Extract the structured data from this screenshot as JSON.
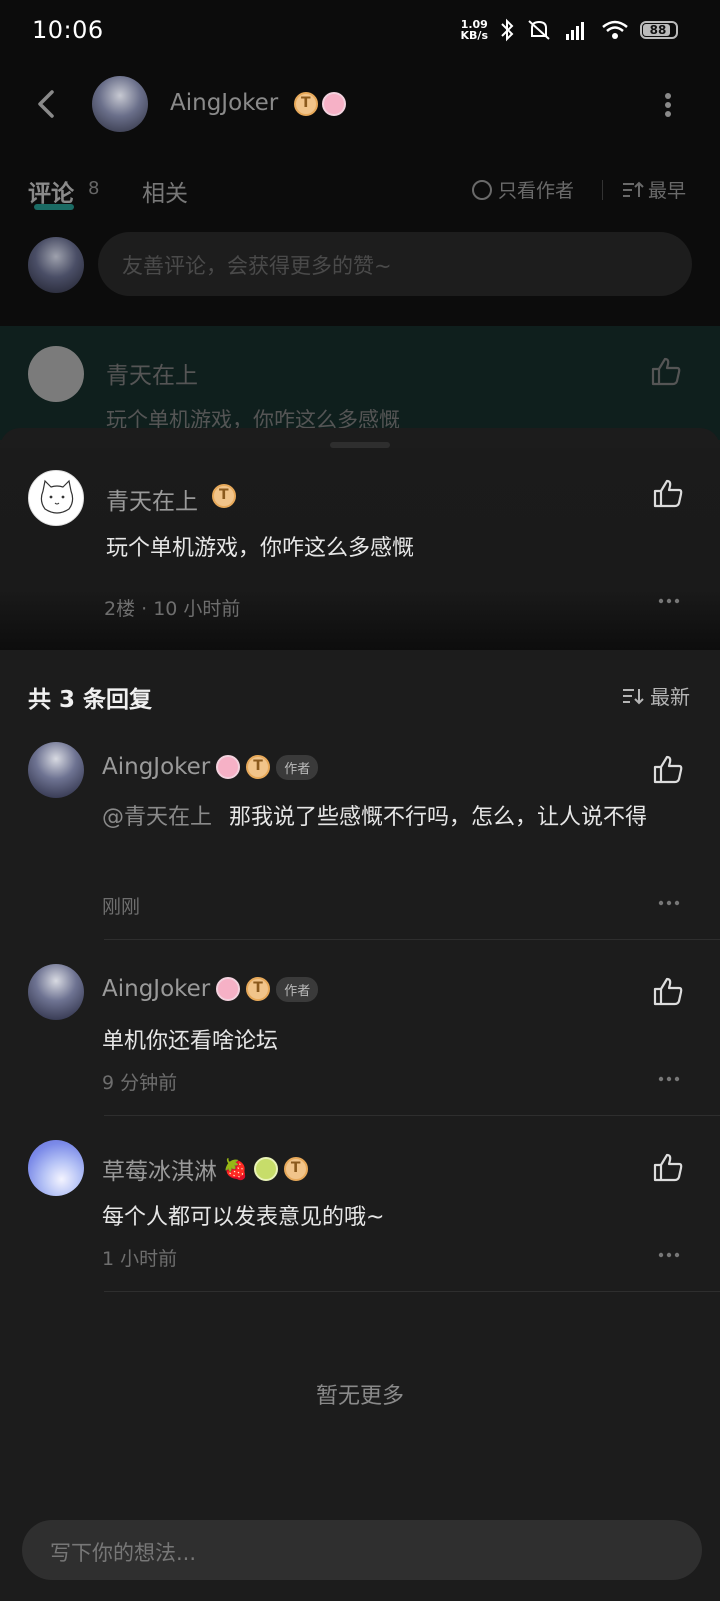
{
  "status_bar": {
    "time": "10:06",
    "net_speed_value": "1.09",
    "net_speed_unit": "KB/s",
    "battery": "88"
  },
  "header": {
    "username": "AingJoker"
  },
  "tabs": {
    "comment_label": "评论",
    "comment_count": "8",
    "related_label": "相关",
    "only_author": "只看作者",
    "sort_earliest": "最早"
  },
  "comment_input": {
    "placeholder": "友善评论，会获得更多的赞~"
  },
  "background_comment": {
    "name": "青天在上",
    "text": "玩个单机游戏，你咋这么多感慨"
  },
  "main_comment": {
    "name": "青天在上",
    "text": "玩个单机游戏，你咋这么多感慨",
    "meta": "2楼 · 10 小时前"
  },
  "replies_header": {
    "title": "共 3 条回复",
    "sort_latest": "最新"
  },
  "replies": [
    {
      "name": "AingJoker",
      "author_tag": "作者",
      "mention": "@青天在上",
      "text": "那我说了些感慨不行吗，怎么，让人说不得",
      "time": "刚刚"
    },
    {
      "name": "AingJoker",
      "author_tag": "作者",
      "text": "单机你还看啥论坛",
      "time": "9 分钟前"
    },
    {
      "name": "草莓冰淇淋",
      "name_emoji": "🍓",
      "text": "每个人都可以发表意见的哦~",
      "time": "1 小时前"
    }
  ],
  "footer": {
    "no_more": "暂无更多",
    "input_placeholder": "写下你的想法..."
  },
  "colors": {
    "accent_teal": "#1a6b64",
    "background": "#1c1c1c",
    "input_bg": "#2f2f2f"
  }
}
